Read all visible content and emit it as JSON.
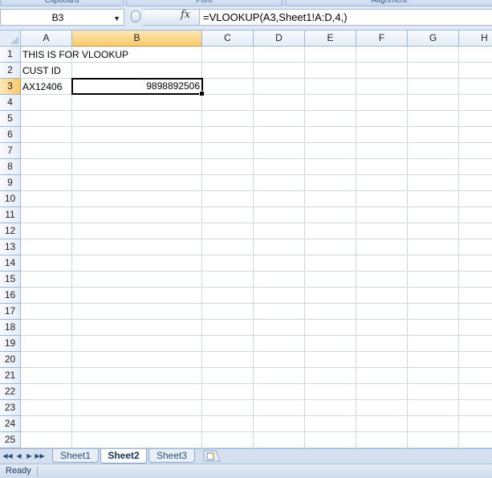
{
  "ribbon": {
    "groups": [
      "Clipboard",
      "Font",
      "Alignment"
    ]
  },
  "formula_bar": {
    "name_box": "B3",
    "fx_label": "fx",
    "formula": "=VLOOKUP(A3,Sheet1!A:D,4,)"
  },
  "columns": [
    "A",
    "B",
    "C",
    "D",
    "E",
    "F",
    "G",
    "H"
  ],
  "rows": [
    "1",
    "2",
    "3",
    "4",
    "5",
    "6",
    "7",
    "8",
    "9",
    "10",
    "11",
    "12",
    "13",
    "14",
    "15",
    "16",
    "17",
    "18",
    "19",
    "20",
    "21",
    "22",
    "23",
    "24",
    "25"
  ],
  "cells": {
    "A1": "THIS IS FOR VLOOKUP",
    "A2": "CUST ID",
    "A3": "AX12406",
    "B3": "9898892506"
  },
  "active_cell": "B3",
  "sheets": {
    "tabs": [
      "Sheet1",
      "Sheet2",
      "Sheet3"
    ],
    "active": "Sheet2"
  },
  "status": {
    "text": "Ready"
  },
  "colors": {
    "ribbon_bg": "#dfe9f5",
    "active_header": "#f8c96b",
    "gridline": "#d0d7e5"
  }
}
